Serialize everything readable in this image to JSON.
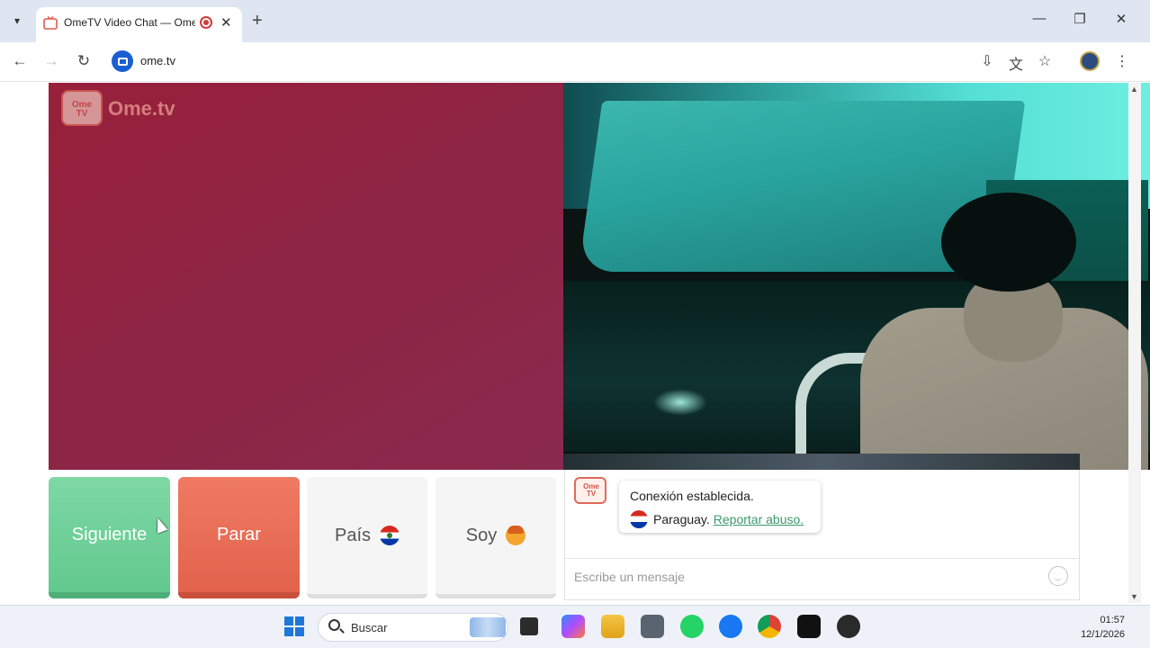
{
  "browser": {
    "tab_title": "OmeTV Video Chat — Ome",
    "new_tab": "+",
    "url": "ome.tv"
  },
  "page": {
    "logo_text": "Ome.tv",
    "logo_badge": "Ome TV",
    "buttons": {
      "next": "Siguiente",
      "stop": "Parar",
      "country": "País",
      "sex": "Soy"
    },
    "chat": {
      "logo_badge": "Ome TV",
      "message_line1": "Conexión establecida.",
      "country_name": "Paraguay.",
      "report_link": "Reportar abuso.",
      "input_placeholder": "Escribe un mensaje"
    }
  },
  "taskbar": {
    "search_placeholder": "Buscar",
    "time": "01:57",
    "date": "12/1/2026"
  },
  "colors": {
    "next": "#6fd19a",
    "stop": "#e86d55",
    "link": "#3a9a6a",
    "left_video": "#8e2443"
  }
}
